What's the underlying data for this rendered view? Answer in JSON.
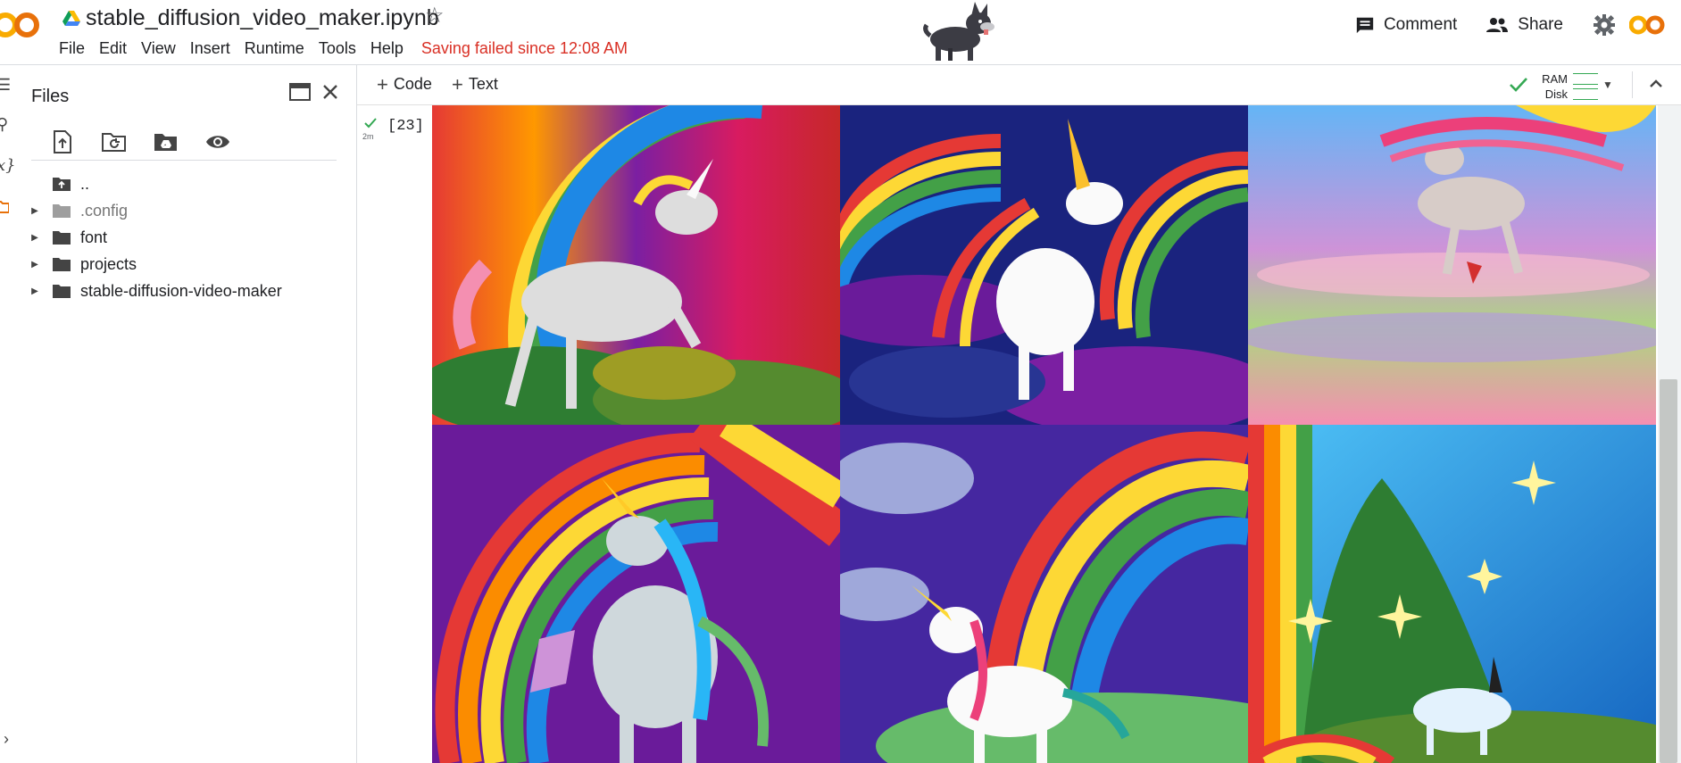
{
  "notebook": {
    "title": "stable_diffusion_video_maker.ipynb",
    "menu": [
      "File",
      "Edit",
      "View",
      "Insert",
      "Runtime",
      "Tools",
      "Help"
    ],
    "status": "Saving failed since 12:08 AM"
  },
  "header_right": {
    "comment": "Comment",
    "share": "Share"
  },
  "logo_text": "CO",
  "sidebar": {
    "title": "Files",
    "tree": [
      {
        "label": "..",
        "type": "parent"
      },
      {
        "label": ".config",
        "type": "folder",
        "dim": true
      },
      {
        "label": "font",
        "type": "folder"
      },
      {
        "label": "projects",
        "type": "folder"
      },
      {
        "label": "stable-diffusion-video-maker",
        "type": "folder"
      }
    ]
  },
  "toolbar": {
    "code_label": "Code",
    "text_label": "Text",
    "ram_label": "RAM",
    "disk_label": "Disk"
  },
  "cell": {
    "exec_count": "[23]",
    "run_time": "2m"
  },
  "output_images": [
    "unicorn-rainbow-1",
    "unicorn-rainbow-2",
    "unicorn-rainbow-3",
    "unicorn-rainbow-4",
    "unicorn-rainbow-5",
    "unicorn-rainbow-6"
  ],
  "colors": {
    "accent_orange": "#f9ab00",
    "error_red": "#d93025",
    "ok_green": "#34a853"
  }
}
